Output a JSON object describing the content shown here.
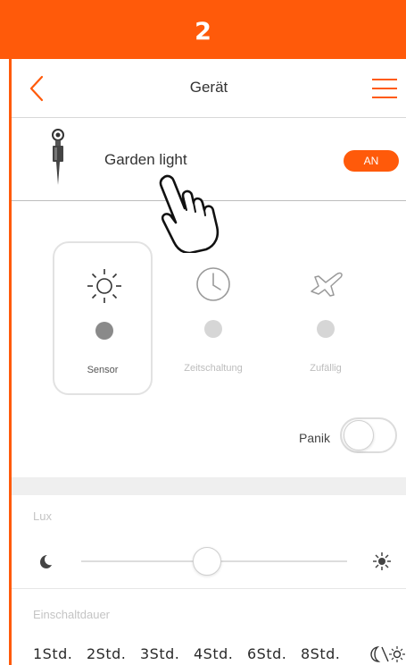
{
  "step": {
    "number": "2"
  },
  "header": {
    "title": "Gerät"
  },
  "device": {
    "name": "Garden light",
    "status_badge": "AN"
  },
  "modes": [
    {
      "label": "Sensor",
      "icon": "sun-icon",
      "selected": true
    },
    {
      "label": "Zeitschaltung",
      "icon": "clock-icon",
      "selected": false
    },
    {
      "label": "Zufällig",
      "icon": "airplane-icon",
      "selected": false
    }
  ],
  "panik": {
    "label": "Panik",
    "enabled": false
  },
  "lux": {
    "label": "Lux",
    "level_fraction": 0.5
  },
  "duration": {
    "label": "Einschaltdauer",
    "options": [
      "1Std.",
      "2Std.",
      "3Std.",
      "4Std.",
      "6Std.",
      "8Std."
    ],
    "extra_icon": "moon-sun-icon"
  },
  "colors": {
    "accent": "#ff5a0a",
    "divider": "#efefef",
    "muted_text": "#c4c4c4"
  }
}
